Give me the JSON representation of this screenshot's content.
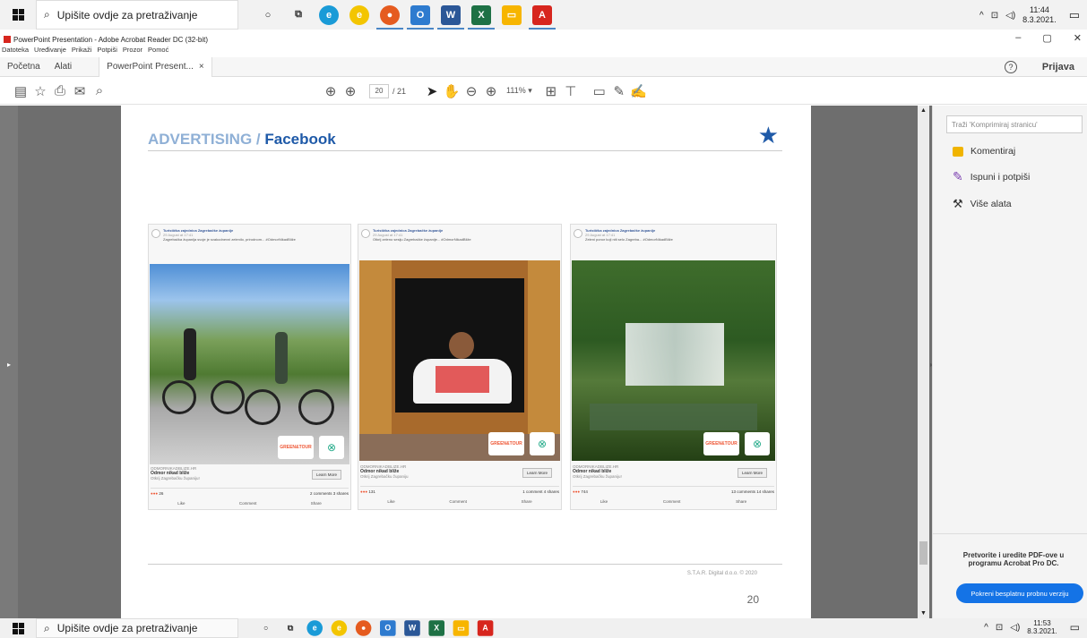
{
  "taskbar": {
    "search_placeholder": "Upišite ovdje za pretraživanje",
    "time_top": "11:44",
    "date_top": "8.3.2021.",
    "time_bottom": "11:53",
    "date_bottom": "8.3.2021."
  },
  "window": {
    "title": "PowerPoint Presentation - Adobe Acrobat Reader DC (32-bit)",
    "minimize": "–",
    "maximize": "▢",
    "close": "✕"
  },
  "menu": [
    "Datoteka",
    "Uređivanje",
    "Prikaži",
    "Potpiši",
    "Prozor",
    "Pomoć"
  ],
  "tabs": {
    "home": "Početna",
    "tools": "Alati",
    "document": "PowerPoint Present...",
    "help": "?",
    "signin": "Prijava"
  },
  "toolbar": {
    "page_current": "20",
    "page_total": "/ 21",
    "zoom": "111%"
  },
  "slide": {
    "title_part1": "ADVERTISING / ",
    "title_part2": "Facebook",
    "footer": "S.T.A.R. Digital d.o.o. © 2020",
    "page_number": "20",
    "ads": [
      {
        "page": "Turistička zajednica Zagrebačke županije",
        "date": "29 August at 17:41",
        "text": "Zagrebačka županija svoje je svakodnevni zelenilo, prirodnom... #OdmorNikadBliže",
        "domain": "ODMORNIKADBLIZE.HR",
        "headline": "Odmor nikad bliže",
        "sub": "Otkrij Zagrebačku županiju!",
        "cta": "Learn More",
        "reactions": "26",
        "comments": "2 comments  3 shares"
      },
      {
        "page": "Turistička zajednica Zagrebačke županije",
        "date": "29 August at 17:41",
        "text": "Otkrij zeleno sesiju Zagrebačke županije... #OdmorNikadBliže",
        "domain": "ODMORNIKADBLIZE.HR",
        "headline": "Odmor nikad bliže",
        "sub": "Otkrij Zagrebačku županiju",
        "cta": "Learn More",
        "reactions": "131",
        "comments": "1 comment  4 shares"
      },
      {
        "page": "Turistička zajednica Zagrebačke županije",
        "date": "29 August at 17:41",
        "text": "Zeleni ponor koji niti selo Zagreba... #OdmorNikadBliže",
        "domain": "ODMORNIKADBLIZE.HR",
        "headline": "Odmor nikad bliže",
        "sub": "Otkrij Zagrebačku županiju!",
        "cta": "Learn More",
        "reactions": "744",
        "comments": "13 comments  14 shares"
      }
    ],
    "actions": [
      "Like",
      "Comment",
      "Share"
    ],
    "logo_text": "GREEN&TOUR"
  },
  "right_panel": {
    "search_placeholder": "Traži 'Komprimiraj stranicu'",
    "items": [
      "Komentiraj",
      "Ispuni i potpiši",
      "Više alata"
    ],
    "promo": "Pretvorite i uredite PDF-ove u programu Acrobat Pro DC.",
    "promo_button": "Pokreni besplatnu probnu verziju"
  },
  "colors": {
    "title_light": "#8fb0d6",
    "title_dark": "#1f5aa8",
    "promo_button": "#1473e6",
    "pdf_red": "#d7261e"
  }
}
